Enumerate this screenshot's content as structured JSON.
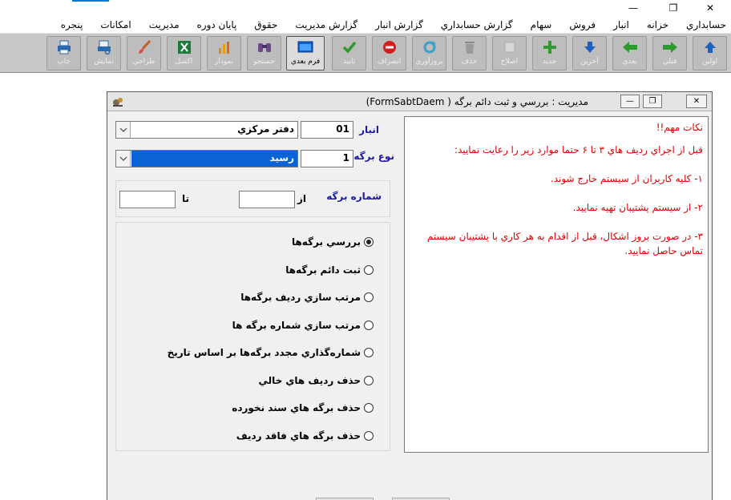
{
  "window": {
    "minimize_glyph": "—",
    "maximize_glyph": "❐",
    "close_glyph": "✕"
  },
  "menu": {
    "items": [
      "حسابداري",
      "خزانه",
      "انبار",
      "فروش",
      "سهام",
      "گزارش حسابداري",
      "گزارش انبار",
      "گزارش مديريت",
      "حقوق",
      "پایان دوره",
      "مديريت",
      "امکانات",
      "پنجره"
    ]
  },
  "toolbar": {
    "buttons": [
      {
        "label": "اولين",
        "icon": "arrow-up-icon",
        "color": "#1f5fbf"
      },
      {
        "label": "قبلي",
        "icon": "arrow-right-icon",
        "color": "#2e9a2e"
      },
      {
        "label": "بعدي",
        "icon": "arrow-left-icon",
        "color": "#2e9a2e"
      },
      {
        "label": "آخرين",
        "icon": "arrow-down-icon",
        "color": "#1f5fbf"
      },
      {
        "label": "جديد",
        "icon": "plus-icon",
        "color": "#2e9a2e"
      },
      {
        "label": "اصلاح",
        "icon": "edit-icon",
        "color": "#cccccc"
      },
      {
        "label": "حذف",
        "icon": "trash-icon",
        "color": "#8a8a8a"
      },
      {
        "label": "بروزآوري",
        "icon": "refresh-icon",
        "color": "#3aa0c8"
      },
      {
        "label": "انصراف",
        "icon": "cancel-icon",
        "color": "#d22020"
      },
      {
        "label": "تاييد",
        "icon": "check-icon",
        "color": "#2e9a2e"
      },
      {
        "label": "فرم بعدي",
        "icon": "window-icon",
        "color": "#1060d0"
      },
      {
        "label": "جستجو",
        "icon": "binoculars-icon",
        "color": "#6a4a8a"
      },
      {
        "label": "نمودار",
        "icon": "chart-icon",
        "color": "#e08a10"
      },
      {
        "label": "اکسل",
        "icon": "excel-icon",
        "color": "#1d7a3a"
      },
      {
        "label": "طراحي",
        "icon": "brush-icon",
        "color": "#c0602a"
      },
      {
        "label": "نمايش",
        "icon": "preview-icon",
        "color": "#2a6ab0"
      },
      {
        "label": "چاپ",
        "icon": "printer-icon",
        "color": "#2a6ab0"
      }
    ]
  },
  "form": {
    "title": "مديريت : بررسي و ثبت دائم برگه  ( FormSabtDaem)",
    "store": {
      "label": "انبار",
      "code": "01",
      "name": "دفتر مرکزي"
    },
    "doc_type": {
      "label": "نوع برگه",
      "code": "1",
      "name": "رسيد"
    },
    "doc_number": {
      "label": "شماره برگه",
      "from_label": "از",
      "to_label": "تا",
      "from_value": "",
      "to_value": ""
    },
    "options": [
      {
        "label": "بررسي برگه‌ها",
        "checked": true
      },
      {
        "label": "ثبت دائم برگه‌ها",
        "checked": false
      },
      {
        "label": "مرتب سازي رديف برگه‌ها",
        "checked": false
      },
      {
        "label": "مرتب سازي شماره برگه ها",
        "checked": false
      },
      {
        "label": "شماره‌گذاري مجدد برگه‌ها بر اساس تاريخ",
        "checked": false
      },
      {
        "label": "حذف رديف هاي خالي",
        "checked": false
      },
      {
        "label": "حذف برگه هاي سند نخورده",
        "checked": false
      },
      {
        "label": "حذف برگه هاي فاقد رديف",
        "checked": false
      }
    ],
    "notes": {
      "title": "نکات مهم!!",
      "lines": [
        "قبل از اجراي رديف هاي ۳ تا ۶ حتما موارد زير را رعايت نماييد:",
        "۱- کليه کاربران از سيستم خارج شوند.",
        "۲- از سيستم  پشتيبان تهيه نماييد.",
        "۳- در صورت بروز اشکال، قبل از اقدام به هر کاري با پشتيبان سيستم تماس حاصل نماييد."
      ],
      "color": "#e00000"
    }
  },
  "colors": {
    "label_blue": "#1a1aa8",
    "selection_blue": "#0a64d8",
    "toolbar_bg": "#c8c8c8"
  }
}
